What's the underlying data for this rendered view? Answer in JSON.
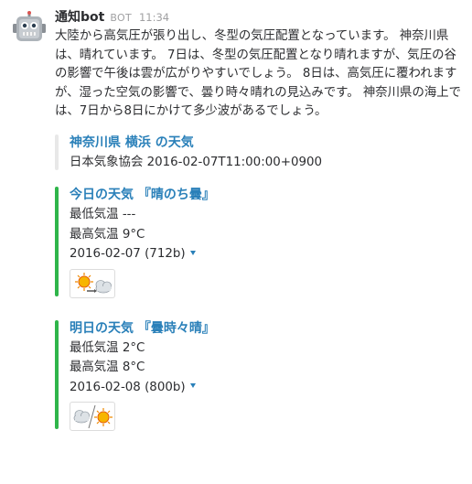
{
  "message": {
    "sender": "通知bot",
    "badge": "BOT",
    "time": "11:34",
    "avatar_icon": "robot-icon",
    "text": "大陸から高気圧が張り出し、冬型の気圧配置となっています。 神奈川県は、晴れています。 7日は、冬型の気圧配置となり晴れますが、気圧の谷の影響で午後は雲が広がりやすいでしょう。 8日は、高気圧に覆われますが、湿った空気の影響で、曇り時々晴れの見込みです。 神奈川県の海上では、7日から8日にかけて多少波があるでしょう。"
  },
  "source_attachment": {
    "title": "神奈川県 横浜 の天気",
    "subtitle": "日本気象協会 2016-02-07T11:00:00+0900",
    "bar_color": "#e8e8e8"
  },
  "forecasts": [
    {
      "title": "今日の天気 『晴のち曇』",
      "min_temp": "最低気温 ---",
      "max_temp": "最高気温 9°C",
      "image_label": "2016-02-07 (712b)",
      "icon": "sunny-then-cloudy-icon",
      "bar_color": "#2fb54a"
    },
    {
      "title": "明日の天気 『曇時々晴』",
      "min_temp": "最低気温 2°C",
      "max_temp": "最高気温 8°C",
      "image_label": "2016-02-08 (800b)",
      "icon": "cloudy-sometimes-sunny-icon",
      "bar_color": "#2fb54a"
    }
  ]
}
